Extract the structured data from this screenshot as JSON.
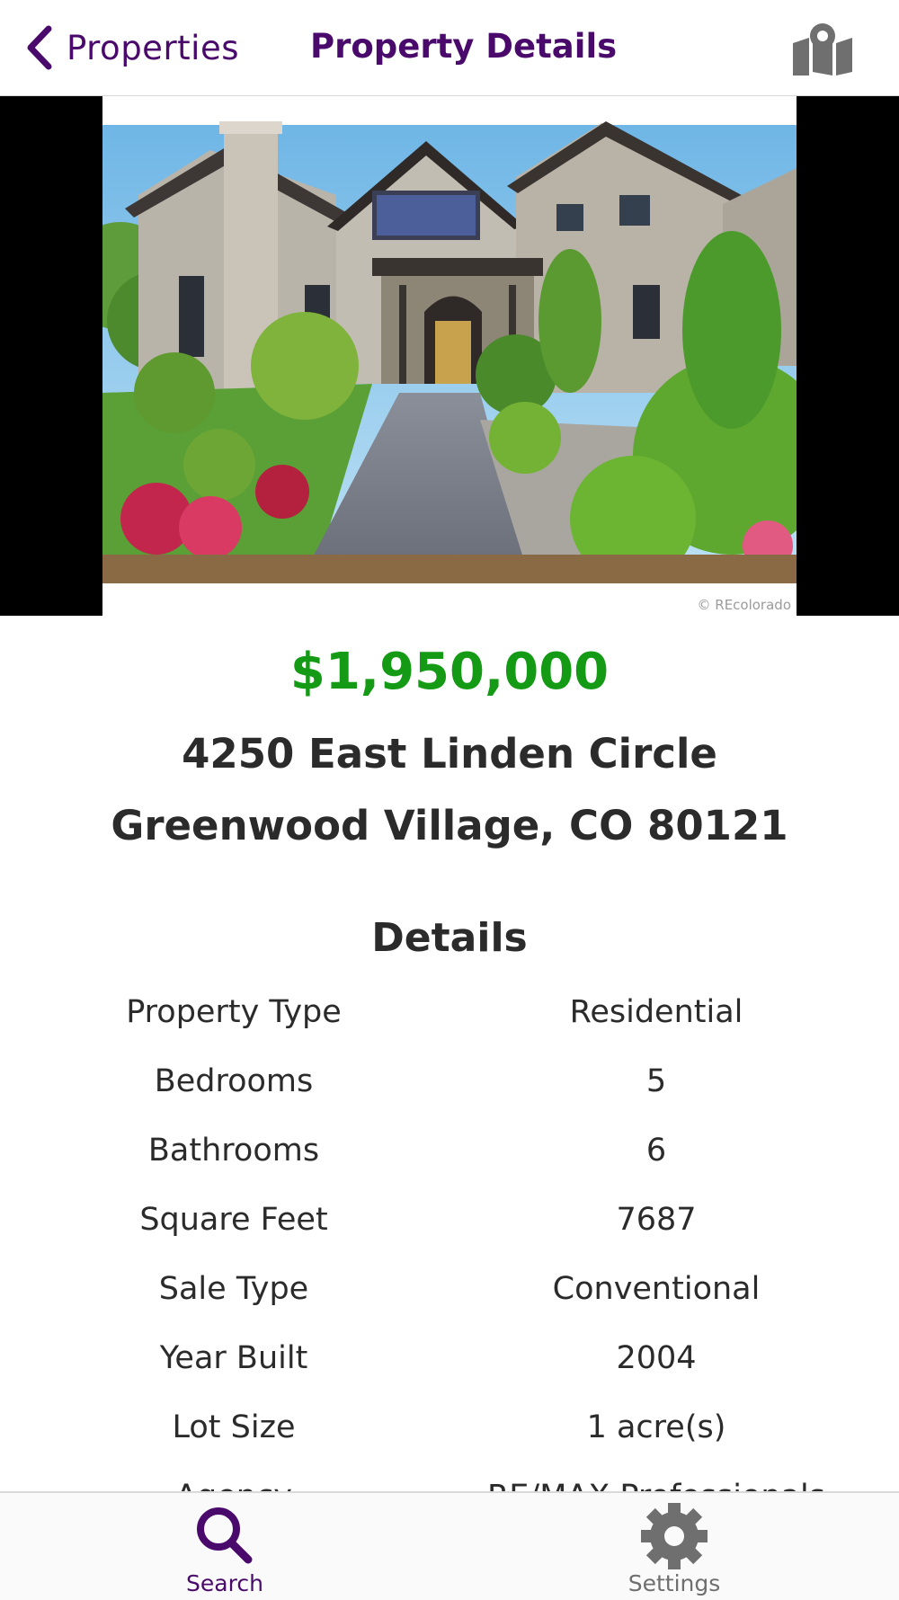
{
  "header": {
    "back_label": "Properties",
    "title": "Property Details",
    "map_icon": "map-marker-icon"
  },
  "photo": {
    "watermark": "© REcolorado"
  },
  "listing": {
    "price": "$1,950,000",
    "address_line1": "4250 East Linden Circle",
    "address_line2": "Greenwood Village, CO 80121"
  },
  "details": {
    "title": "Details",
    "rows": [
      {
        "label": "Property Type",
        "value": "Residential"
      },
      {
        "label": "Bedrooms",
        "value": "5"
      },
      {
        "label": "Bathrooms",
        "value": "6"
      },
      {
        "label": "Square Feet",
        "value": "7687"
      },
      {
        "label": "Sale Type",
        "value": "Conventional"
      },
      {
        "label": "Year Built",
        "value": "2004"
      },
      {
        "label": "Lot Size",
        "value": "1 acre(s)"
      },
      {
        "label": "Agency",
        "value": "RE/MAX Professionals"
      }
    ]
  },
  "tabs": [
    {
      "label": "Search",
      "icon": "search-icon",
      "active": true
    },
    {
      "label": "Settings",
      "icon": "gear-icon",
      "active": false
    }
  ],
  "colors": {
    "brand": "#4a0a6b",
    "price": "#159a16",
    "inactive": "#6f6f6f"
  }
}
